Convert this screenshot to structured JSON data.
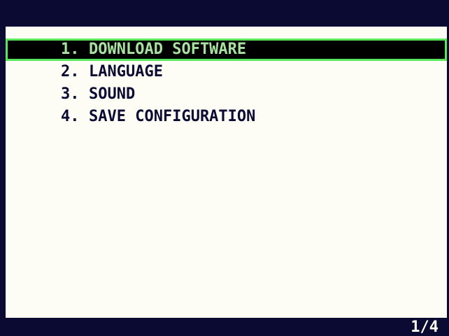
{
  "menu": {
    "items": [
      {
        "number": "1.",
        "label": "DOWNLOAD SOFTWARE",
        "selected": true
      },
      {
        "number": "2.",
        "label": "LANGUAGE",
        "selected": false
      },
      {
        "number": "3.",
        "label": "SOUND",
        "selected": false
      },
      {
        "number": "4.",
        "label": "SAVE CONFIGURATION",
        "selected": false
      }
    ]
  },
  "status": {
    "page": "1/4"
  },
  "colors": {
    "background": "#fdfdf6",
    "bars": "#0a0a33",
    "highlight_bg": "#000000",
    "highlight_border": "#5ae85a",
    "highlight_text": "#a8e2a0"
  }
}
